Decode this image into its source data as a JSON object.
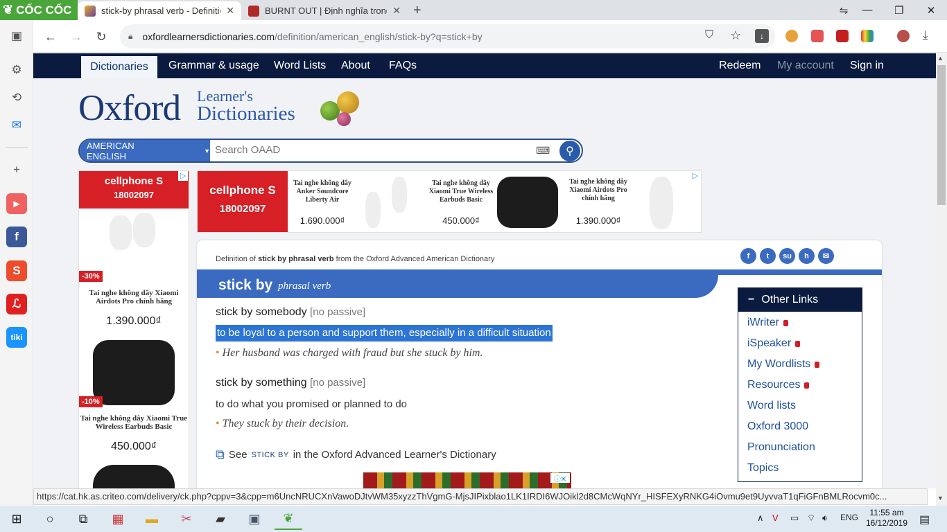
{
  "browser": {
    "brand": "CỐC CỐC",
    "tabs": [
      {
        "title": "stick-by phrasal verb - Definition, p"
      },
      {
        "title": "BURNT OUT | Định nghĩa trong Từ"
      }
    ],
    "new_tab": "+",
    "url_host": "oxfordlearnersdictionaries.com",
    "url_path": "/definition/american_english/stick-by?q=stick+by"
  },
  "site_nav": {
    "tabs": [
      "Dictionaries",
      "Grammar & usage",
      "Word Lists",
      "About",
      "FAQs"
    ],
    "right": [
      "Redeem",
      "My account",
      "Sign in"
    ]
  },
  "logo": {
    "word": "Oxford",
    "line1": "Learner's",
    "line2": "Dictionaries"
  },
  "search": {
    "dictionary": "AMERICAN ENGLISH",
    "placeholder": "Search OAAD"
  },
  "ad_left": {
    "brand": "cellphone S",
    "phone": "18002097",
    "items": [
      {
        "discount": "-30%",
        "title": "Tai nghe không dây Xiaomi Airdots Pro chính hãng",
        "price": "1.390.000₫"
      },
      {
        "discount": "-10%",
        "title": "Tai nghe không dây Xiaomi True Wireless Earbuds Basic",
        "price": "450.000₫"
      }
    ]
  },
  "ad_top": {
    "brand": "cellphone S",
    "phone": "18002097",
    "items": [
      {
        "title": "Tai nghe không dây Anker Soundcore Liberty Air",
        "price": "1.690.000₫"
      },
      {
        "title": "Tai nghe không dây Xiaomi True Wireless Earbuds Basic",
        "price": "450.000₫"
      },
      {
        "title": "Tai nghe không dây Xiaomi Airdots Pro chính hãng",
        "price": "1.390.000₫"
      }
    ]
  },
  "entry": {
    "crumb_pre": "Definition of",
    "crumb_word": "stick by phrasal verb",
    "crumb_post": "from the Oxford Advanced American Dictionary",
    "headword": "stick by",
    "pos": "phrasal verb",
    "senses": [
      {
        "phrase": "stick by somebody",
        "grammar": "[no passive]",
        "definition": "to be loyal to a person and support them, especially in a difficult situation",
        "example": "Her husband was charged with fraud but she stuck by him."
      },
      {
        "phrase": "stick by something",
        "grammar": "[no passive]",
        "definition": "to do what you promised or planned to do",
        "example": "They stuck by their decision."
      }
    ],
    "see_pre": "See",
    "see_word": "STICK BY",
    "see_post": "in the Oxford Advanced Learner's Dictionary"
  },
  "other_links": {
    "title": "Other Links",
    "items": [
      "iWriter",
      "iSpeaker",
      "My Wordlists",
      "Resources",
      "Word lists",
      "Oxford 3000",
      "Pronunciation",
      "Topics"
    ]
  },
  "status_url": "https://cat.hk.as.criteo.com/delivery/ck.php?cppv=3&cpp=m6UncNRUCXnVawoDJtvWM35xyzzThVgmG-MjsJIPixblao1LK1IRDI6WJOikl2d8CMcWqNYr_HISFEXyRNKG4iOvmu9et9UyvvaT1qFiGFnBMLRocvm0c...",
  "taskbar": {
    "lang": "ENG",
    "time": "11:55 am",
    "date": "16/12/2019"
  },
  "colors": {
    "nav": "#0a1b3f",
    "accent": "#3b6bc1",
    "highlight": "#2c75d4",
    "ad_red": "#d71f26",
    "coccoc_green": "#4aa53b"
  }
}
